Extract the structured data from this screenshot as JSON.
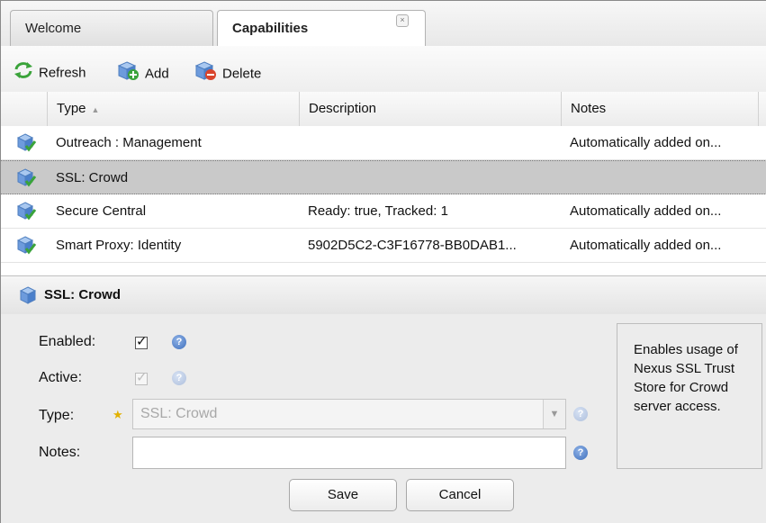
{
  "tabs": [
    {
      "label": "Welcome",
      "active": false
    },
    {
      "label": "Capabilities",
      "active": true,
      "close": "×"
    }
  ],
  "toolbar": {
    "refresh_label": "Refresh",
    "add_label": "Add",
    "delete_label": "Delete"
  },
  "grid": {
    "columns": [
      "Type",
      "Description",
      "Notes"
    ],
    "sort_indicator": "▲",
    "rows": [
      {
        "type": "Outreach : Management",
        "description": "",
        "notes": "Automatically added on..."
      },
      {
        "type": "SSL: Crowd",
        "description": "",
        "notes": "",
        "selected": true
      },
      {
        "type": "Secure Central",
        "description": "Ready: true, Tracked: 1",
        "notes": "Automatically added on..."
      },
      {
        "type": "Smart Proxy: Identity",
        "description": "5902D5C2-C3F16778-BB0DAB1...",
        "notes": "Automatically added on..."
      }
    ]
  },
  "detail": {
    "title": "SSL: Crowd",
    "fields": {
      "enabled_label": "Enabled:",
      "enabled_checked": true,
      "active_label": "Active:",
      "active_checked": true,
      "type_label": "Type:",
      "type_value": "SSL: Crowd",
      "notes_label": "Notes:",
      "notes_value": ""
    },
    "help_glyph": "?",
    "check_glyph": "✓",
    "info_text": "Enables usage of Nexus SSL Trust Store for Crowd server access.",
    "save_label": "Save",
    "cancel_label": "Cancel"
  },
  "colors": {
    "selected_row": "#c9c9c9",
    "help_icon": "#3e6fbd",
    "capability_icon": "#5b8fd6",
    "ok_badge": "#3aa33a",
    "refresh_icon": "#3aa33a",
    "delete_badge": "#d9442c"
  }
}
